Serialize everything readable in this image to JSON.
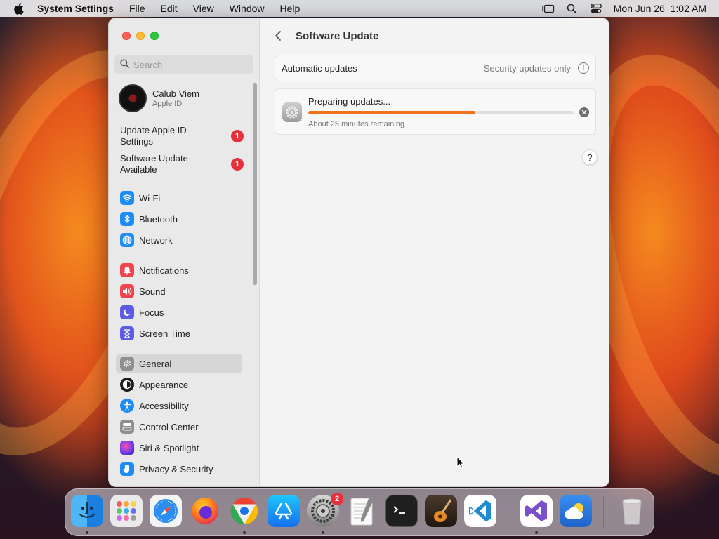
{
  "menubar": {
    "app_name": "System Settings",
    "menus": [
      "File",
      "Edit",
      "View",
      "Window",
      "Help"
    ],
    "clock": "Mon Jun 26  1:02 AM",
    "status_icons": [
      "stage-manager-icon",
      "spotlight-search-icon",
      "control-center-icon"
    ]
  },
  "sidebar": {
    "search_placeholder": "Search",
    "account": {
      "name": "Calub Viem",
      "subtitle": "Apple ID"
    },
    "notices": [
      {
        "label": "Update Apple ID Settings",
        "badge": "1"
      },
      {
        "label": "Software Update Available",
        "badge": "1"
      }
    ],
    "groups": [
      [
        {
          "label": "Wi-Fi",
          "icon": "wifi-icon",
          "color": "#1e8cf5"
        },
        {
          "label": "Bluetooth",
          "icon": "bluetooth-icon",
          "color": "#1e8cf5"
        },
        {
          "label": "Network",
          "icon": "globe-icon",
          "color": "#1e8cf5"
        }
      ],
      [
        {
          "label": "Notifications",
          "icon": "bell-icon",
          "color": "#f0444e"
        },
        {
          "label": "Sound",
          "icon": "speaker-icon",
          "color": "#f0444e"
        },
        {
          "label": "Focus",
          "icon": "moon-icon",
          "color": "#5e5ce6"
        },
        {
          "label": "Screen Time",
          "icon": "hourglass-icon",
          "color": "#5e5ce6"
        }
      ],
      [
        {
          "label": "General",
          "icon": "gear-icon",
          "color": "#8e8e93",
          "selected": true
        },
        {
          "label": "Appearance",
          "icon": "appearance-icon",
          "color": "#1c1c1e"
        },
        {
          "label": "Accessibility",
          "icon": "accessibility-icon",
          "color": "#1e8cf5"
        },
        {
          "label": "Control Center",
          "icon": "control-center-icon",
          "color": "#8e8e93"
        },
        {
          "label": "Siri & Spotlight",
          "icon": "siri-icon",
          "color": "#7b3fe4"
        },
        {
          "label": "Privacy & Security",
          "icon": "hand-icon",
          "color": "#1e8cf5"
        }
      ]
    ]
  },
  "content": {
    "title": "Software Update",
    "auto_updates": {
      "label": "Automatic updates",
      "value": "Security updates only"
    },
    "progress": {
      "title": "Preparing updates...",
      "subtitle": "About 25 minutes remaining",
      "fraction": 0.63
    },
    "help_label": "?"
  },
  "dock": {
    "apps": [
      {
        "name": "finder-icon",
        "running": true
      },
      {
        "name": "launchpad-icon",
        "running": false
      },
      {
        "name": "safari-icon",
        "running": false
      },
      {
        "name": "firefox-icon",
        "running": false
      },
      {
        "name": "chrome-icon",
        "running": true
      },
      {
        "name": "app-store-icon",
        "running": false
      },
      {
        "name": "system-settings-icon",
        "running": true,
        "badge": "2"
      },
      {
        "name": "textedit-icon",
        "running": false
      },
      {
        "name": "terminal-icon",
        "running": false
      },
      {
        "name": "garageband-icon",
        "running": false
      },
      {
        "name": "vscode-icon",
        "running": false
      },
      {
        "name": "visual-studio-icon",
        "running": true
      },
      {
        "name": "weather-icon",
        "running": false
      },
      {
        "name": "trash-icon",
        "running": false
      }
    ]
  }
}
